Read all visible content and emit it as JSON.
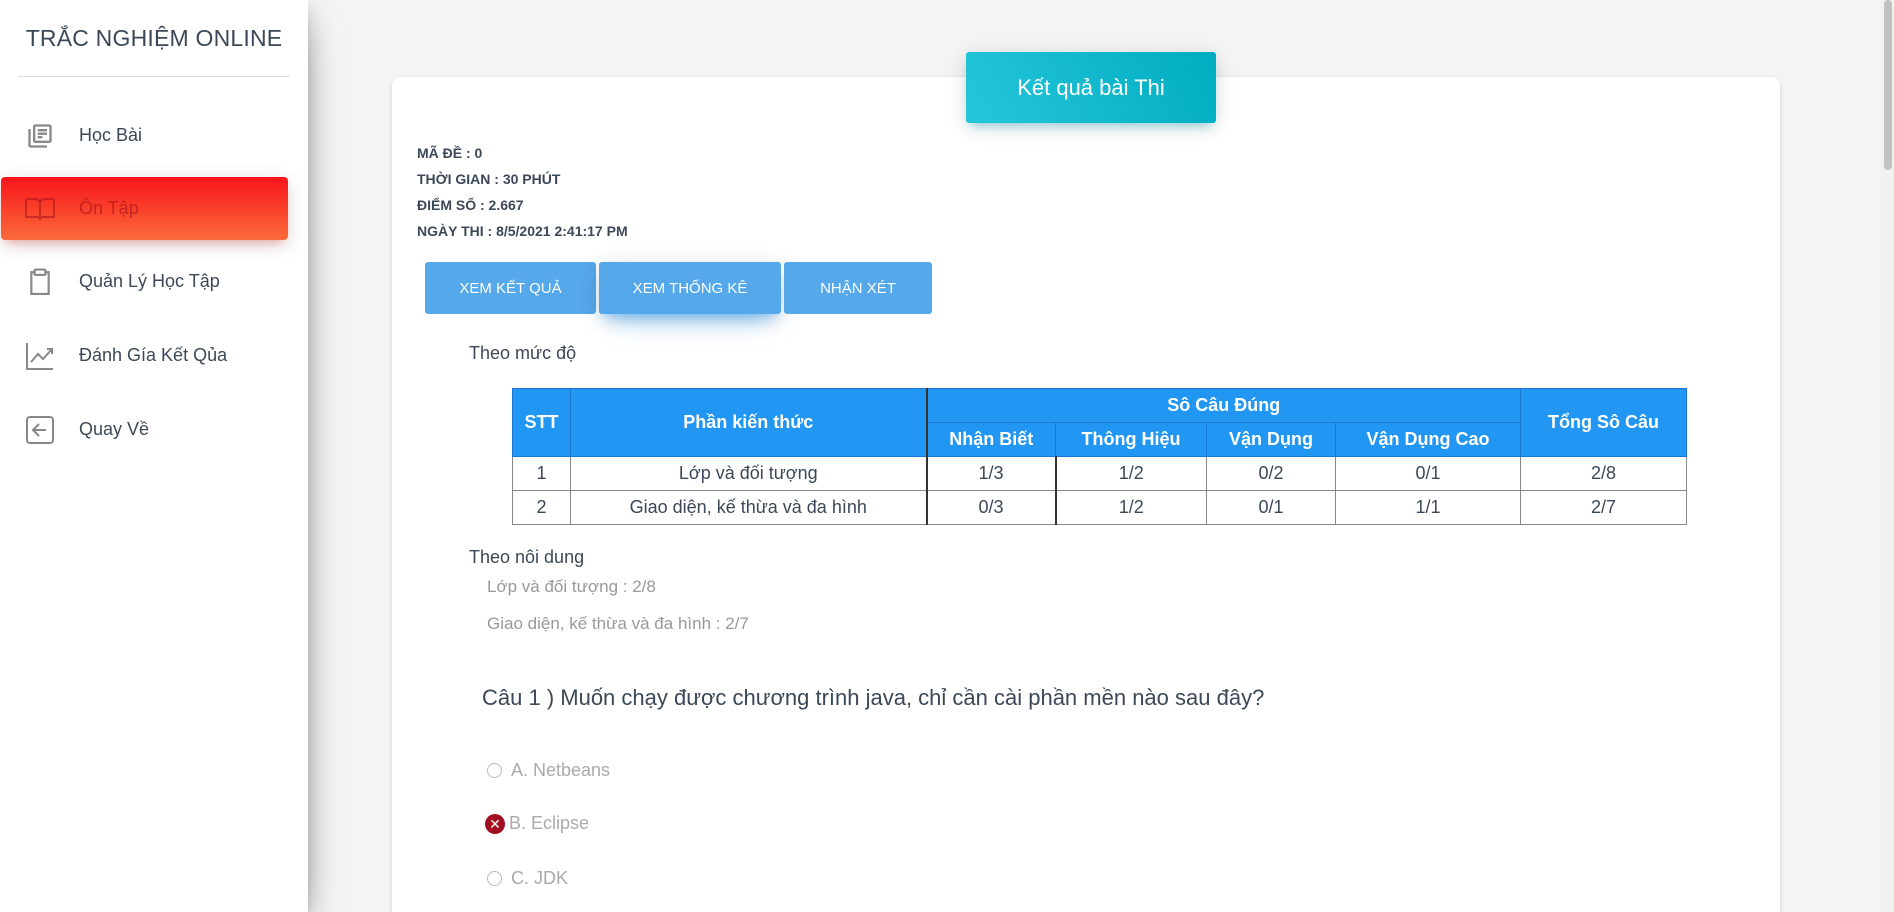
{
  "app": {
    "brand": "TRẮC NGHIỆM ONLINE"
  },
  "sidebar": {
    "items": [
      {
        "label": "Học Bài",
        "icon": "library-books-icon"
      },
      {
        "label": "Ôn Tập",
        "icon": "open-book-icon",
        "active": true
      },
      {
        "label": "Quản Lý Học Tập",
        "icon": "clipboard-icon"
      },
      {
        "label": "Đánh Gía Kết Qủa",
        "icon": "trending-up-icon"
      },
      {
        "label": "Quay Về",
        "icon": "back-arrow-icon"
      }
    ]
  },
  "header": {
    "title": "Kết quả bài Thi"
  },
  "meta": {
    "ma_de": "MÃ ĐỀ : 0",
    "thoi_gian": "THỜI GIAN : 30 PHÚT",
    "diem_so": "ĐIỂM SỐ : 2.667",
    "ngay_thi": "NGÀY THI : 8/5/2021 2:41:17 PM"
  },
  "actions": {
    "xem_ket_qua": "XEM KẾT QUẢ",
    "xem_thong_ke": "XEM THỐNG KÊ",
    "nhan_xet": "NHẬN XÉT"
  },
  "level_section": {
    "label": "Theo mức độ"
  },
  "table": {
    "headers": {
      "stt": "STT",
      "phan_kien_thuc": "Phần kiến thức",
      "so_cau_dung": "Sô Câu Đúng",
      "nhan_biet": "Nhận Biết",
      "thong_hieu": "Thông Hiệu",
      "van_dung": "Vận Dụng",
      "van_dung_cao": "Vận Dụng Cao",
      "tong_so_cau": "Tổng Sô Câu"
    },
    "rows": [
      {
        "stt": "1",
        "phan": "Lớp và đối tượng",
        "nhan_biet": "1/3",
        "thong_hieu": "1/2",
        "van_dung": "0/2",
        "van_dung_cao": "0/1",
        "tong": "2/8"
      },
      {
        "stt": "2",
        "phan": "Giao diện, kế thừa và đa hình",
        "nhan_biet": "0/3",
        "thong_hieu": "1/2",
        "van_dung": "0/1",
        "van_dung_cao": "1/1",
        "tong": "2/7"
      }
    ]
  },
  "content_section": {
    "label": "Theo nôi dung",
    "lines": [
      "Lớp và đối tượng : 2/8",
      "Giao diện, kế thừa và đa hình : 2/7"
    ]
  },
  "question": {
    "text": "Câu 1 ) Muốn chạy được chương trình java, chỉ cần cài phần mền nào sau đây?",
    "options": [
      {
        "label": "A. Netbeans",
        "state": "unselected"
      },
      {
        "label": "B. Eclipse",
        "state": "wrong"
      },
      {
        "label": "C. JDK",
        "state": "unselected"
      }
    ]
  },
  "colors": {
    "active_gradient_start": "#f8141c",
    "active_gradient_end": "#fb6b3a",
    "header_teal": "#00acc1",
    "button_blue": "#55a8ea",
    "table_header_blue": "#2196f3",
    "wrong_red": "#a01020"
  }
}
